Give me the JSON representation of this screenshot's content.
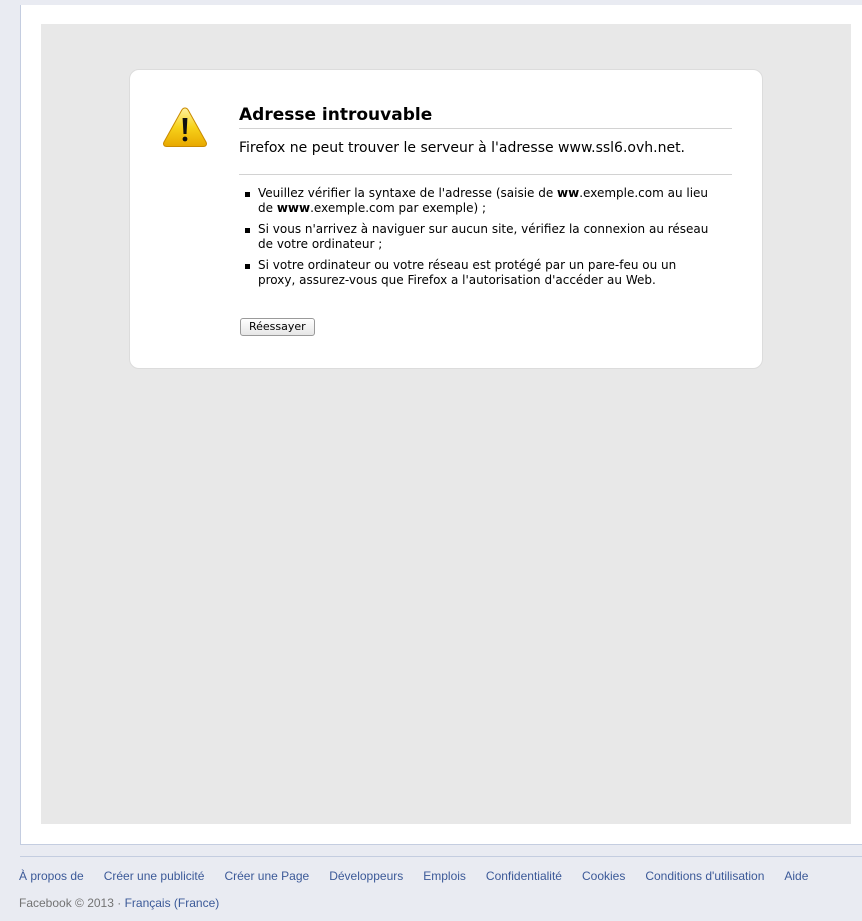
{
  "error": {
    "title": "Adresse introuvable",
    "description": "Firefox ne peut trouver le serveur à l'adresse www.ssl6.ovh.net.",
    "suggestions": [
      {
        "text_before": "Veuillez vérifier la syntaxe de l'adresse (saisie de ",
        "bold1": "ww",
        "text_mid1": ".exemple.com au lieu de ",
        "bold2": "www",
        "text_after": ".exemple.com par exemple) ;"
      },
      {
        "text": "Si vous n'arrivez à naviguer sur aucun site, vérifiez la connexion au réseau de votre ordinateur ;"
      },
      {
        "text": "Si votre ordinateur ou votre réseau est protégé par un pare-feu ou un proxy, assurez-vous que Firefox a l'autorisation d'accéder au Web."
      }
    ],
    "retry_label": "Réessayer",
    "icon": "warning-icon",
    "icon_color": "#f5c400"
  },
  "footer": {
    "links": [
      "À propos de",
      "Créer une publicité",
      "Créer une Page",
      "Développeurs",
      "Emplois",
      "Confidentialité",
      "Cookies",
      "Conditions d'utilisation",
      "Aide"
    ],
    "copyright": "Facebook © 2013 · ",
    "language": "Français (France)",
    "link_color": "#3b5998"
  }
}
